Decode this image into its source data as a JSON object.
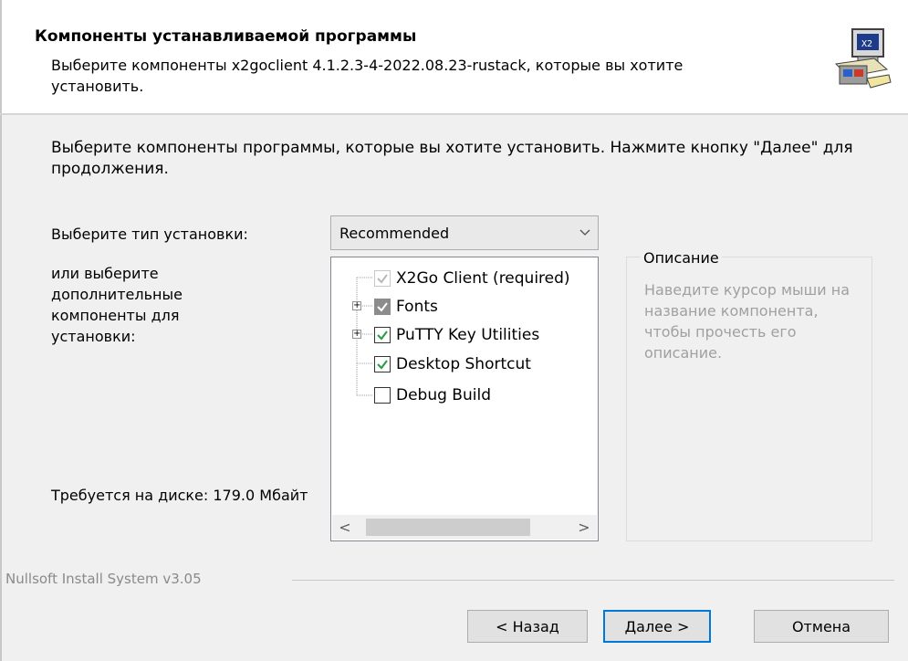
{
  "header": {
    "title": "Компоненты устанавливаемой программы",
    "subtitle": "Выберите компоненты x2goclient 4.1.2.3-4-2022.08.23-rustack, которые вы хотите установить.",
    "icon": "installer-computer-icon"
  },
  "intro": "Выберите компоненты программы, которые вы хотите установить. Нажмите кнопку \"Далее\" для продолжения.",
  "install_type": {
    "label": "Выберите тип установки:",
    "selected": "Recommended"
  },
  "components_label": "или выберите дополнительные компоненты для установки:",
  "disk_space": "Требуется на диске: 179.0 Мбайт",
  "components": [
    {
      "label": "X2Go Client (required)",
      "state": "checked-disabled",
      "expandable": false
    },
    {
      "label": "Fonts",
      "state": "partial",
      "expandable": true
    },
    {
      "label": "PuTTY Key Utilities",
      "state": "checked",
      "expandable": true
    },
    {
      "label": "Desktop Shortcut",
      "state": "checked",
      "expandable": false
    },
    {
      "label": "Debug Build",
      "state": "unchecked",
      "expandable": false
    }
  ],
  "description": {
    "title": "Описание",
    "text": "Наведите курсор мыши на название компонента, чтобы прочесть его описание."
  },
  "footer": {
    "brand": "Nullsoft Install System v3.05"
  },
  "buttons": {
    "back": "< Назад",
    "next": "Далее >",
    "cancel": "Отмена"
  },
  "colors": {
    "accent": "#0078d7",
    "check": "#2e9c4a",
    "disabled_text": "#a0a0a0"
  }
}
